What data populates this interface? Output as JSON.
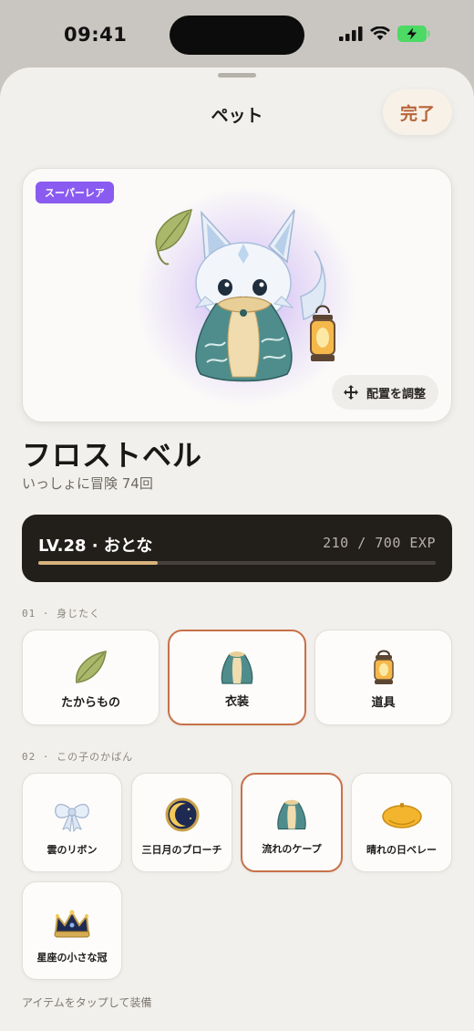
{
  "status_bar": {
    "time": "09:41"
  },
  "header": {
    "title": "ペット",
    "done_label": "完了"
  },
  "hero": {
    "rarity": "スーパーレア",
    "adjust_label": "配置を調整"
  },
  "pet": {
    "name": "フロストベル",
    "subtitle": "いっしょに冒険 74回"
  },
  "level": {
    "label": "LV.28 · おとな",
    "exp_text": "210 / 700 EXP",
    "exp_progress": 0.3
  },
  "sections": {
    "equip": {
      "label": "01 · 身じたく",
      "slots": [
        {
          "label": "たからもの",
          "icon": "leaf-icon",
          "selected": false
        },
        {
          "label": "衣装",
          "icon": "cape-icon",
          "selected": true
        },
        {
          "label": "道具",
          "icon": "lantern-icon",
          "selected": false
        }
      ]
    },
    "bag": {
      "label": "02 · この子のかばん",
      "items": [
        {
          "label": "雲のリボン",
          "icon": "ribbon-icon",
          "selected": false
        },
        {
          "label": "三日月のブローチ",
          "icon": "moon-brooch-icon",
          "selected": false
        },
        {
          "label": "流れのケープ",
          "icon": "cape-icon",
          "selected": true
        },
        {
          "label": "晴れの日ベレー",
          "icon": "beret-icon",
          "selected": false
        },
        {
          "label": "星座の小さな冠",
          "icon": "crown-icon",
          "selected": false
        }
      ]
    }
  },
  "hint": "アイテムをタップして装備",
  "colors": {
    "accent": "#c8714a",
    "rarity": "#8a5bf0",
    "exp_fill": "#d8b27c"
  }
}
